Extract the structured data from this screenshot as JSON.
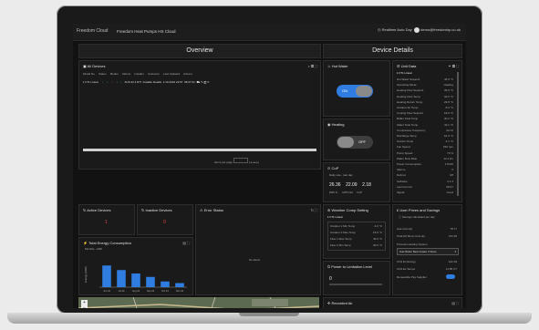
{
  "app": {
    "logo": "Freedom Cloud",
    "title": "Freedom Heat Pumps HS Cloud",
    "status": "Realtime  Auto Day",
    "user": "demo@freedomhp.co.uk"
  },
  "sections": {
    "overview": "Overview",
    "device_details": "Device Details"
  },
  "all_devices": {
    "title": "All Devices",
    "columns": [
      "Model No",
      "Status",
      "Modes",
      "Alarms",
      "Installer",
      "Customer",
      "Last Updated",
      "Actions"
    ],
    "row": [
      "1 FTL Linear",
      "•",
      "•",
      "•",
      "•",
      "•",
      "FHS 42 4 RTI",
      "Installer Details",
      "4.10.2024 23:57",
      "08:47:21"
    ],
    "pagination": "Items per page"
  },
  "hot_water": {
    "title": "Hot Water",
    "toggle": "ON"
  },
  "heating": {
    "title": "Heating",
    "toggle": "OFF"
  },
  "cop": {
    "title": "CoP",
    "subtitle": "Daily rate - last day",
    "values": [
      "26.36",
      "22.09",
      "2.18"
    ],
    "labels": [
      "kWh In",
      "kWh Out",
      "CoP"
    ]
  },
  "unit_data": {
    "title": "Unit Data",
    "unit": "1 FTL Linear",
    "rows": [
      [
        "Hot Water Setpoint",
        "45.0 °C"
      ],
      [
        "Operating Mode",
        "Heating"
      ],
      [
        "Heating Flow Setpoint",
        "35.0 °C"
      ],
      [
        "Heating Flow Temp",
        "32.6 °C"
      ],
      [
        "Heating Return Temp",
        "29.8 °C"
      ],
      [
        "Outdoor Air Temp",
        "8.4 °C"
      ],
      [
        "Cooling Flow Setpoint",
        "18.0 °C"
      ],
      [
        "Buffer Tank Temp",
        "30.2 °C"
      ],
      [
        "Water Tank Temp",
        "44.1 °C"
      ],
      [
        "Compressor Frequency",
        "42 Hz"
      ],
      [
        "Discharge Temp",
        "61.3 °C"
      ],
      [
        "Suction Temp",
        "4.1 °C"
      ],
      [
        "Fan Speed",
        "540 rpm"
      ],
      [
        "Pump Speed",
        "70 %"
      ],
      [
        "Water Flow Rate",
        "12.4 l/m"
      ],
      [
        "Power Consumption",
        "1.8 kW"
      ],
      [
        "Alarms",
        "0"
      ],
      [
        "Defrost",
        "Off"
      ],
      [
        "Software",
        "2.1.4"
      ],
      [
        "Last Comms",
        "08:47"
      ],
      [
        "Signal",
        "Good"
      ]
    ]
  },
  "active_devices": {
    "title": "Active Devices",
    "value": "1"
  },
  "inactive_devices": {
    "title": "Inactive Devices",
    "value": "0"
  },
  "error_status": {
    "title": "Error Status",
    "empty": "No alerts"
  },
  "weather_comp": {
    "title": "Weather Comp Setting",
    "unit": "1 FTL Linear",
    "rows": [
      [
        "Outdoor 1 Min Temp",
        "-3.0 °C"
      ],
      [
        "Outdoor 2 Max Temp",
        "15.0 °C"
      ],
      [
        "Flow 1 Max Temp",
        "45.0 °C"
      ],
      [
        "Flow 2 Min Temp",
        "30.0 °C"
      ]
    ]
  },
  "user_prices": {
    "title": "User Prices and Savings",
    "subtitle": "Savings calculated per day",
    "rows": [
      [
        "Gas Cost (£)",
        "78.77"
      ],
      [
        "Total HP Runn Cost (£)",
        "371.35"
      ]
    ],
    "dropdown_label": "Previous Heating System",
    "dropdown_value": "Gas Boiler Best Grade 3 Stars",
    "extra_rows": [
      [
        "CO2 Ex Energy",
        "£11.09"
      ],
      [
        "CO2 Ex Temps",
        "11.85 CT"
      ]
    ],
    "toggle_label": "Renewable Pay Supplier"
  },
  "power": {
    "title": "Power to Limitation Level",
    "value": "0"
  },
  "energy": {
    "title": "Total Energy Consumption",
    "subtitle": "Monthly - kWh",
    "ylabel": "Energy (kWh)"
  },
  "chart_data": {
    "type": "bar",
    "categories": [
      "Jun 24",
      "Jul 24",
      "Aug 24",
      "Sep 24",
      "Oct 24",
      "Nov 24"
    ],
    "values": [
      95,
      75,
      60,
      45,
      25,
      18
    ],
    "ylim": [
      0,
      120
    ]
  },
  "recorded_air": {
    "title": "Recorded Air"
  },
  "colors": {
    "accent": "#2f7de0",
    "panel": "#1a1a1a",
    "bg": "#121212"
  }
}
